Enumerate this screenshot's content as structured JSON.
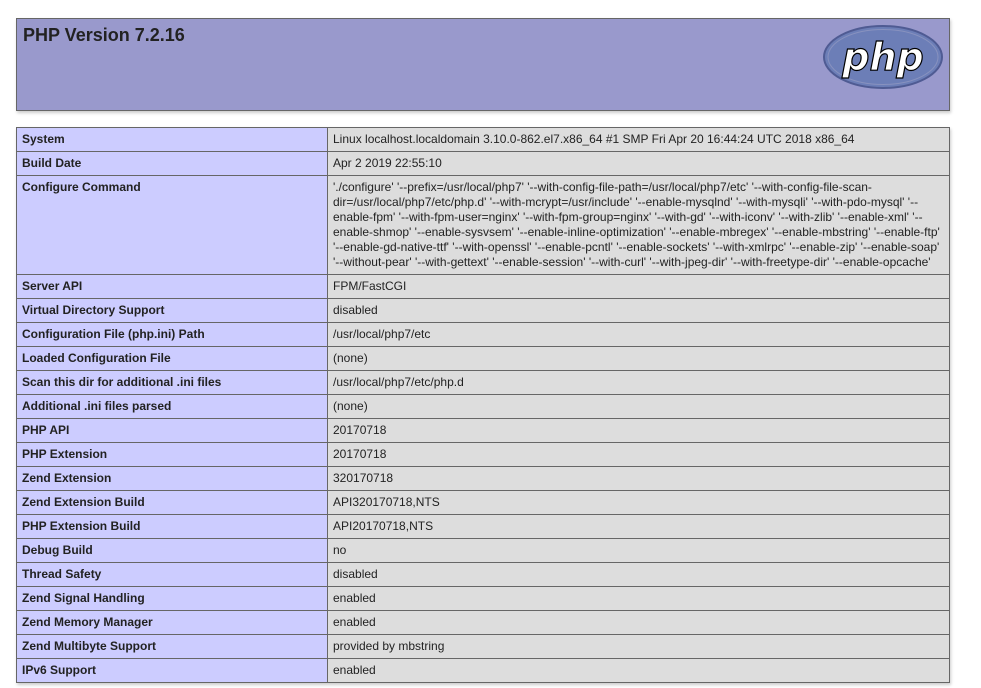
{
  "header": {
    "title": "PHP Version 7.2.16",
    "logo_text": "php"
  },
  "rows": [
    {
      "key": "System",
      "value": "Linux localhost.localdomain 3.10.0-862.el7.x86_64 #1 SMP Fri Apr 20 16:44:24 UTC 2018 x86_64"
    },
    {
      "key": "Build Date",
      "value": "Apr 2 2019 22:55:10"
    },
    {
      "key": "Configure Command",
      "value": "'./configure' '--prefix=/usr/local/php7' '--with-config-file-path=/usr/local/php7/etc' '--with-config-file-scan-dir=/usr/local/php7/etc/php.d' '--with-mcrypt=/usr/include' '--enable-mysqlnd' '--with-mysqli' '--with-pdo-mysql' '--enable-fpm' '--with-fpm-user=nginx' '--with-fpm-group=nginx' '--with-gd' '--with-iconv' '--with-zlib' '--enable-xml' '--enable-shmop' '--enable-sysvsem' '--enable-inline-optimization' '--enable-mbregex' '--enable-mbstring' '--enable-ftp' '--enable-gd-native-ttf' '--with-openssl' '--enable-pcntl' '--enable-sockets' '--with-xmlrpc' '--enable-zip' '--enable-soap' '--without-pear' '--with-gettext' '--enable-session' '--with-curl' '--with-jpeg-dir' '--with-freetype-dir' '--enable-opcache'"
    },
    {
      "key": "Server API",
      "value": "FPM/FastCGI"
    },
    {
      "key": "Virtual Directory Support",
      "value": "disabled"
    },
    {
      "key": "Configuration File (php.ini) Path",
      "value": "/usr/local/php7/etc"
    },
    {
      "key": "Loaded Configuration File",
      "value": "(none)"
    },
    {
      "key": "Scan this dir for additional .ini files",
      "value": "/usr/local/php7/etc/php.d"
    },
    {
      "key": "Additional .ini files parsed",
      "value": "(none)"
    },
    {
      "key": "PHP API",
      "value": "20170718"
    },
    {
      "key": "PHP Extension",
      "value": "20170718"
    },
    {
      "key": "Zend Extension",
      "value": "320170718"
    },
    {
      "key": "Zend Extension Build",
      "value": "API320170718,NTS"
    },
    {
      "key": "PHP Extension Build",
      "value": "API20170718,NTS"
    },
    {
      "key": "Debug Build",
      "value": "no"
    },
    {
      "key": "Thread Safety",
      "value": "disabled"
    },
    {
      "key": "Zend Signal Handling",
      "value": "enabled"
    },
    {
      "key": "Zend Memory Manager",
      "value": "enabled"
    },
    {
      "key": "Zend Multibyte Support",
      "value": "provided by mbstring"
    },
    {
      "key": "IPv6 Support",
      "value": "enabled"
    }
  ]
}
